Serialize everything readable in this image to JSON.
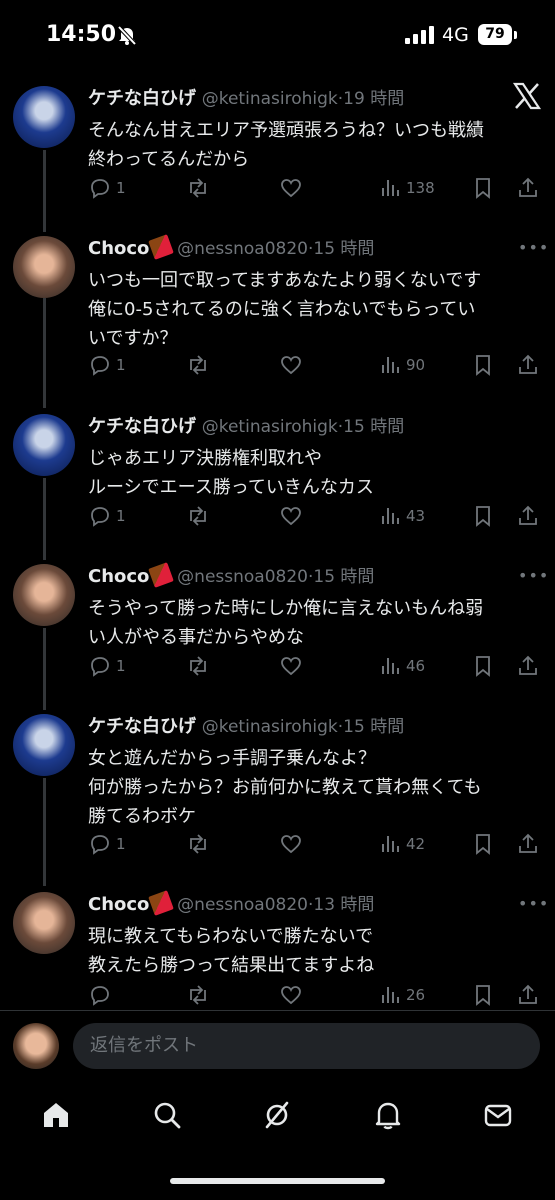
{
  "status_bar": {
    "time": "14:50",
    "network": "4G",
    "battery": "79"
  },
  "tweets": [
    {
      "name": "ケチな白ひげ",
      "handle": "@ketinasirohigk",
      "time": "19 時間",
      "text": "そんなん甘えエリア予選頑張ろうね？いつも戦績\n終わってるんだから",
      "replies": "1",
      "views": "138"
    },
    {
      "name": "Choco",
      "handle": "@nessnoa0820",
      "time": "15 時間",
      "text": "いつも一回で取ってますあなたより弱くないです\n俺に0-5されてるのに強く言わないでもらってい\nいですか？",
      "replies": "1",
      "views": "90"
    },
    {
      "name": "ケチな白ひげ",
      "handle": "@ketinasirohigk",
      "time": "15 時間",
      "text": "じゃあエリア決勝権利取れや\nルーシでエース勝っていきんなカス",
      "replies": "1",
      "views": "43"
    },
    {
      "name": "Choco",
      "handle": "@nessnoa0820",
      "time": "15 時間",
      "text": "そうやって勝った時にしか俺に言えないもんね弱\nい人がやる事だからやめな",
      "replies": "1",
      "views": "46"
    },
    {
      "name": "ケチな白ひげ",
      "handle": "@ketinasirohigk",
      "time": "15 時間",
      "text": "女と遊んだからっ手調子乗んなよ？\n何が勝ったから？お前何かに教えて貰わ無くても\n勝てるわボケ",
      "replies": "1",
      "views": "42"
    },
    {
      "name": "Choco",
      "handle": "@nessnoa0820",
      "time": "13 時間",
      "text": "現に教えてもらわないで勝たないで\n教えたら勝つって結果出てますよね",
      "replies": "",
      "views": "26"
    }
  ],
  "reply_bar": {
    "placeholder": "返信をポスト"
  },
  "nav": [
    "home-icon",
    "search-icon",
    "grok-icon",
    "notifications-icon",
    "messages-icon"
  ]
}
